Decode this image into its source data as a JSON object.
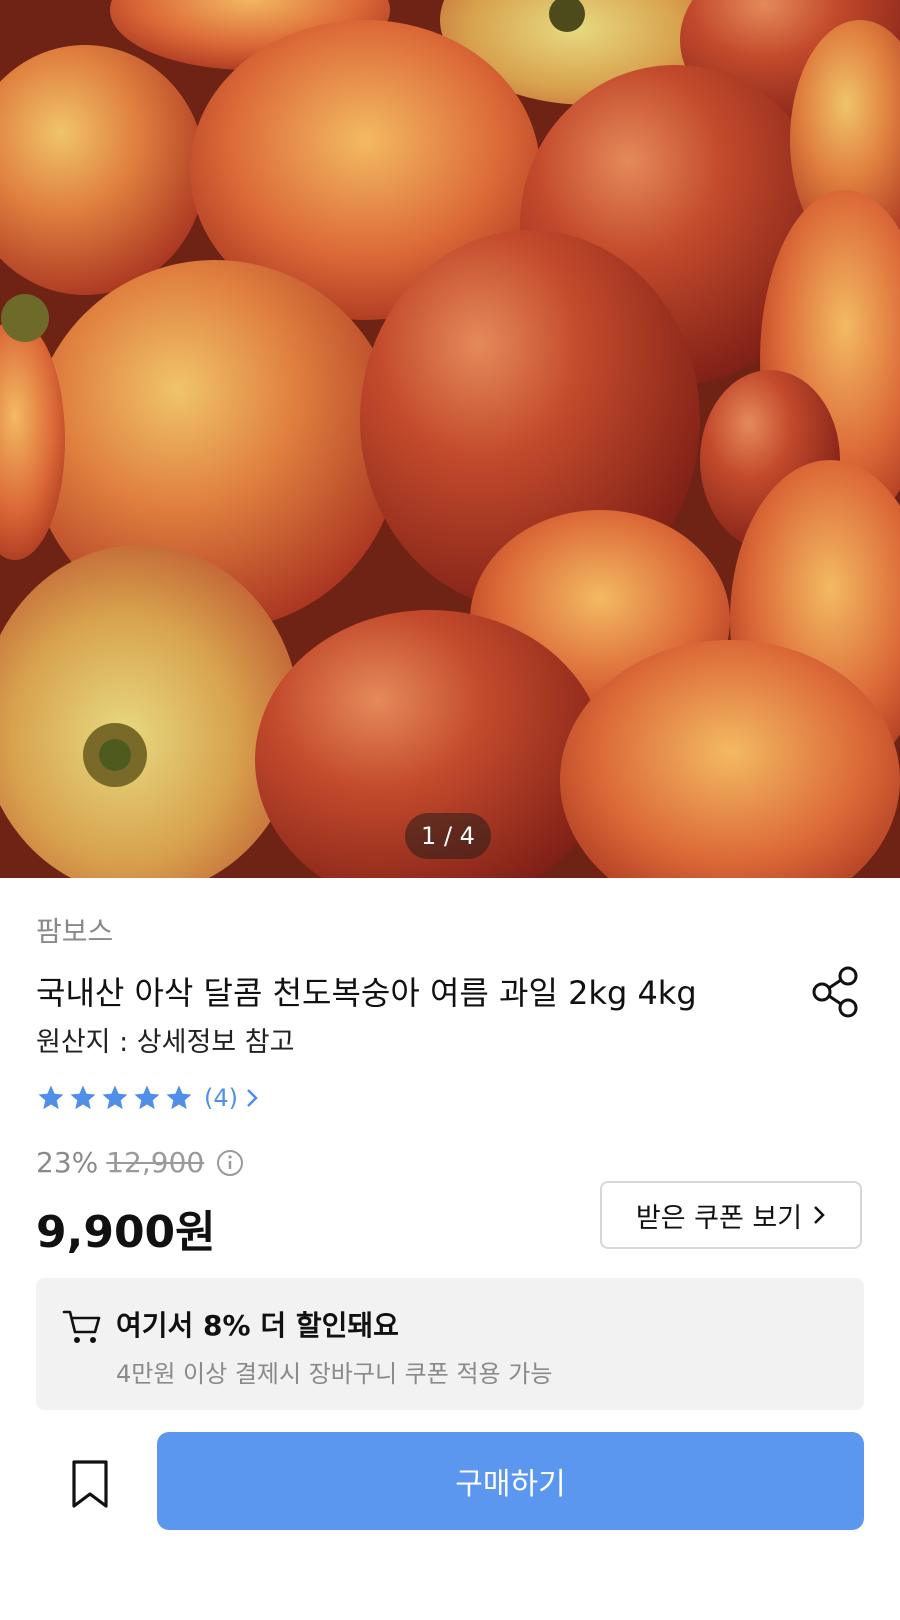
{
  "product_image": {
    "pager": "1 / 4",
    "alt": "fruit photo"
  },
  "seller": "팜보스",
  "title": "국내산 아삭 달콤 천도복숭아 여름 과일 2kg 4kg",
  "origin": "원산지 : 상세정보 참고",
  "rating": {
    "stars": 5,
    "max": 5,
    "count_text": "(4)",
    "star_color": "#4f8fe8"
  },
  "pricing": {
    "discount_percent": "23%",
    "original_price": "12,900",
    "price": "9,900원"
  },
  "coupon_button_label": "받은 쿠폰 보기",
  "promo": {
    "headline": "여기서 8% 더 할인돼요",
    "subtext": "4만원 이상 결제시 장바구니 쿠폰 적용 가능"
  },
  "buy_button_label": "구매하기",
  "colors": {
    "accent": "#5b97ee",
    "promo_bg": "#f2f2f2"
  },
  "icons": [
    "share-icon",
    "star-icon",
    "chevron-right-icon",
    "info-icon",
    "cart-icon",
    "bookmark-icon"
  ]
}
